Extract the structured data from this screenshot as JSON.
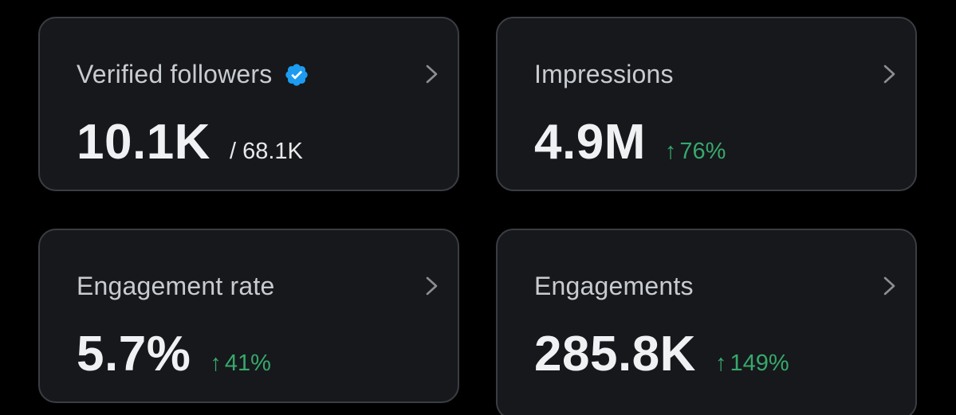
{
  "cards": [
    {
      "title": "Verified followers",
      "value": "10.1K",
      "sub": "/ 68.1K",
      "verified_badge": true
    },
    {
      "title": "Impressions",
      "value": "4.9M",
      "change": "76%",
      "change_arrow": "↑"
    },
    {
      "title": "Engagement rate",
      "value": "5.7%",
      "change": "41%",
      "change_arrow": "↑"
    },
    {
      "title": "Engagements",
      "value": "285.8K",
      "change": "149%",
      "change_arrow": "↑"
    }
  ],
  "colors": {
    "background": "#000000",
    "card": "#16181c",
    "border": "#3a3d42",
    "positive": "#38a86b",
    "badge": "#1d9bf0"
  },
  "icons": {
    "verified": "verified-badge-icon",
    "chevron": "chevron-right-icon",
    "arrow": "arrow-up-icon"
  }
}
